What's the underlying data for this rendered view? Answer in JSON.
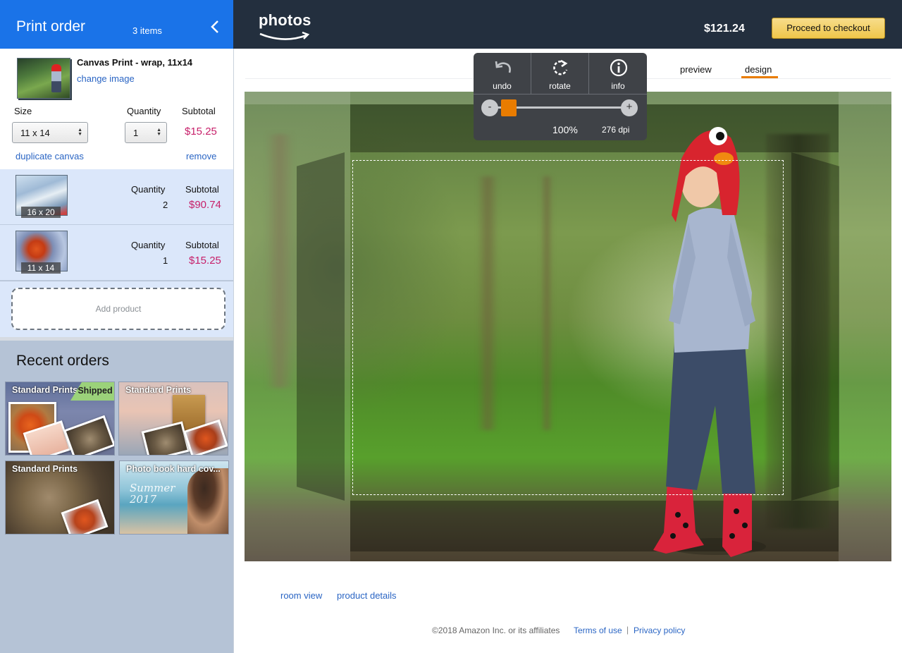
{
  "sidebar": {
    "title": "Print order",
    "item_count": "3 items",
    "current_item": {
      "product_name": "Canvas Print - wrap, 11x14",
      "change_image": "change image",
      "size_label": "Size",
      "quantity_label": "Quantity",
      "subtotal_label": "Subtotal",
      "size_value": "11 x 14",
      "quantity_value": "1",
      "subtotal": "$15.25",
      "duplicate": "duplicate canvas",
      "remove": "remove"
    },
    "items": [
      {
        "size_tag": "16 x 20",
        "quantity_label": "Quantity",
        "quantity": "2",
        "subtotal_label": "Subtotal",
        "subtotal": "$90.74"
      },
      {
        "size_tag": "11 x 14",
        "quantity_label": "Quantity",
        "quantity": "1",
        "subtotal_label": "Subtotal",
        "subtotal": "$15.25"
      }
    ],
    "add_product": "Add product",
    "recent_title": "Recent orders",
    "recent_orders": [
      {
        "title": "Standard Prints",
        "badge": "Shipped"
      },
      {
        "title": "Standard Prints"
      },
      {
        "title": "Standard Prints"
      },
      {
        "title": "Photo book hard cov...",
        "overlay_text": "Summer 2017"
      }
    ]
  },
  "header": {
    "logo_text": "photos",
    "total": "$121.24",
    "checkout": "Proceed to checkout"
  },
  "toolbar": {
    "undo": "undo",
    "rotate": "rotate",
    "info": "info",
    "zoom_minus": "-",
    "zoom_plus": "+",
    "zoom_level": "100%",
    "dpi": "276 dpi"
  },
  "tabs": {
    "preview": "preview",
    "design": "design",
    "active": "design"
  },
  "links": {
    "room_view": "room view",
    "product_details": "product details"
  },
  "footer": {
    "copyright": "©2018 Amazon Inc. or its affiliates",
    "terms": "Terms of use",
    "separator": "|",
    "privacy": "Privacy policy"
  },
  "colors": {
    "sidebar_header": "#1a73e8",
    "topbar": "#232f3e",
    "price": "#c7206a",
    "link": "#2a65c4",
    "accent": "#e97c00",
    "checkout_button": "#efc64a",
    "shipped_badge": "#9bd27a"
  }
}
